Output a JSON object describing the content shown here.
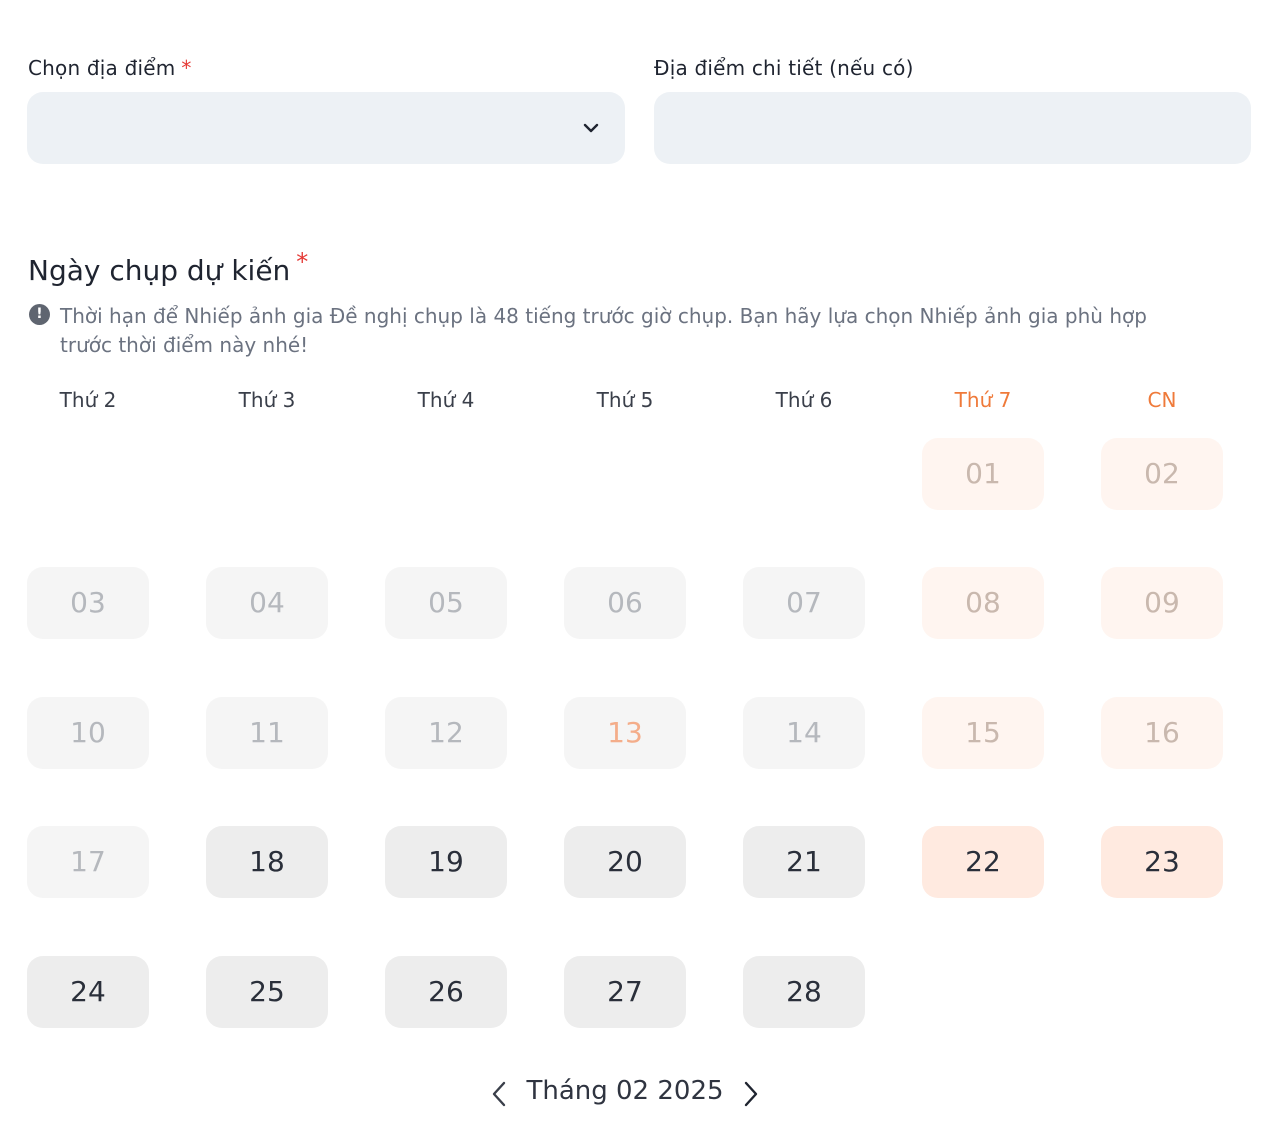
{
  "location": {
    "label": "Chọn địa điểm",
    "required_mark": "*",
    "value": "",
    "icon": "chevron-down-icon"
  },
  "detail": {
    "label": "Địa điểm chi tiết (nếu có)",
    "value": "",
    "placeholder": ""
  },
  "schedule": {
    "title": "Ngày chụp dự kiến",
    "required_mark": "*",
    "notice": "Thời hạn để Nhiếp ảnh gia Đề nghị chụp là 48 tiếng trước giờ chụp. Bạn hãy lựa chọn Nhiếp ảnh gia phù hợp trước thời điểm này nhé!",
    "notice_icon": "info-icon"
  },
  "calendar": {
    "weekdays": [
      "Thứ 2",
      "Thứ 3",
      "Thứ 4",
      "Thứ 5",
      "Thứ 6",
      "Thứ 7",
      "CN"
    ],
    "month_label": "Tháng 02 2025",
    "days": [
      {
        "label": "01",
        "state": "past"
      },
      {
        "label": "02",
        "state": "past"
      },
      {
        "label": "03",
        "state": "past"
      },
      {
        "label": "04",
        "state": "past"
      },
      {
        "label": "05",
        "state": "past"
      },
      {
        "label": "06",
        "state": "past"
      },
      {
        "label": "07",
        "state": "past"
      },
      {
        "label": "08",
        "state": "past"
      },
      {
        "label": "09",
        "state": "past"
      },
      {
        "label": "10",
        "state": "past"
      },
      {
        "label": "11",
        "state": "past"
      },
      {
        "label": "12",
        "state": "past"
      },
      {
        "label": "13",
        "state": "past-holiday"
      },
      {
        "label": "14",
        "state": "past"
      },
      {
        "label": "15",
        "state": "past"
      },
      {
        "label": "16",
        "state": "past"
      },
      {
        "label": "17",
        "state": "past"
      },
      {
        "label": "18",
        "state": "open"
      },
      {
        "label": "19",
        "state": "open"
      },
      {
        "label": "20",
        "state": "open"
      },
      {
        "label": "21",
        "state": "open"
      },
      {
        "label": "22",
        "state": "open"
      },
      {
        "label": "23",
        "state": "open"
      },
      {
        "label": "24",
        "state": "open"
      },
      {
        "label": "25",
        "state": "open"
      },
      {
        "label": "26",
        "state": "open"
      },
      {
        "label": "27",
        "state": "open"
      },
      {
        "label": "28",
        "state": "open"
      }
    ],
    "prev_icon": "chevron-left-icon",
    "next_icon": "chevron-right-icon"
  },
  "colors": {
    "weekend_text": "#ef7a3a",
    "required": "#e53935",
    "field_bg": "#edf1f5"
  }
}
